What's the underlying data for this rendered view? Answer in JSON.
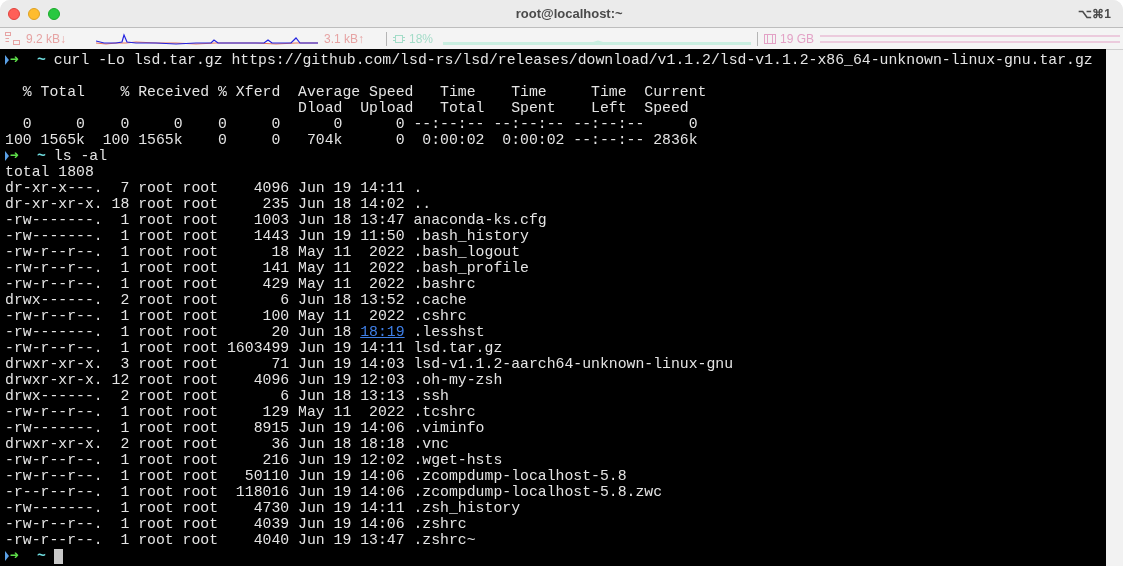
{
  "window": {
    "title": "root@localhost:~",
    "shortcut": "⌥⌘1"
  },
  "status_bar": {
    "network_down": "9.2 kB↓",
    "network_up": "3.1 kB↑",
    "cpu": "18%",
    "memory": "19 GB"
  },
  "terminal": {
    "lines": [
      {
        "kind": "prompt",
        "arrow": "➜",
        "cwd": "~",
        "command": "curl -Lo lsd.tar.gz https://github.com/lsd-rs/lsd/releases/download/v1.1.2/lsd-v1.1.2-x86_64-unknown-linux-gnu.tar.gz",
        "cursor": false
      },
      {
        "kind": "blank"
      },
      {
        "kind": "output",
        "text": "  % Total    % Received % Xferd  Average Speed   Time    Time     Time  Current"
      },
      {
        "kind": "output",
        "text": "                                 Dload  Upload   Total   Spent    Left  Speed"
      },
      {
        "kind": "output",
        "text": "  0     0    0     0    0     0      0      0 --:--:-- --:--:-- --:--:--     0"
      },
      {
        "kind": "output",
        "text": "100 1565k  100 1565k    0     0   704k      0  0:00:02  0:00:02 --:--:-- 2836k"
      },
      {
        "kind": "prompt",
        "arrow": "➜",
        "cwd": "~",
        "command": "ls -al",
        "cursor": false
      },
      {
        "kind": "output",
        "text": "total 1808"
      },
      {
        "kind": "output",
        "text": "dr-xr-x---.  7 root root    4096 Jun 19 14:11 ."
      },
      {
        "kind": "output",
        "text": "dr-xr-xr-x. 18 root root     235 Jun 18 14:02 .."
      },
      {
        "kind": "output",
        "text": "-rw-------.  1 root root    1003 Jun 18 13:47 anaconda-ks.cfg"
      },
      {
        "kind": "output",
        "text": "-rw-------.  1 root root    1443 Jun 19 11:50 .bash_history"
      },
      {
        "kind": "output",
        "text": "-rw-r--r--.  1 root root      18 May 11  2022 .bash_logout"
      },
      {
        "kind": "output",
        "text": "-rw-r--r--.  1 root root     141 May 11  2022 .bash_profile"
      },
      {
        "kind": "output",
        "text": "-rw-r--r--.  1 root root     429 May 11  2022 .bashrc"
      },
      {
        "kind": "output",
        "text": "drwx------.  2 root root       6 Jun 18 13:52 .cache"
      },
      {
        "kind": "output",
        "text": "-rw-r--r--.  1 root root     100 May 11  2022 .cshrc"
      },
      {
        "kind": "segmented",
        "segments": [
          {
            "text": "-rw-------.  1 root root      20 Jun 18 ",
            "link": false
          },
          {
            "text": "18:19",
            "link": true
          },
          {
            "text": " .lesshst",
            "link": false
          }
        ]
      },
      {
        "kind": "output",
        "text": "-rw-r--r--.  1 root root 1603499 Jun 19 14:11 lsd.tar.gz"
      },
      {
        "kind": "output",
        "text": "drwxr-xr-x.  3 root root      71 Jun 19 14:03 lsd-v1.1.2-aarch64-unknown-linux-gnu"
      },
      {
        "kind": "output",
        "text": "drwxr-xr-x. 12 root root    4096 Jun 19 12:03 .oh-my-zsh"
      },
      {
        "kind": "output",
        "text": "drwx------.  2 root root       6 Jun 18 13:13 .ssh"
      },
      {
        "kind": "output",
        "text": "-rw-r--r--.  1 root root     129 May 11  2022 .tcshrc"
      },
      {
        "kind": "output",
        "text": "-rw-------.  1 root root    8915 Jun 19 14:06 .viminfo"
      },
      {
        "kind": "output",
        "text": "drwxr-xr-x.  2 root root      36 Jun 18 18:18 .vnc"
      },
      {
        "kind": "output",
        "text": "-rw-r--r--.  1 root root     216 Jun 19 12:02 .wget-hsts"
      },
      {
        "kind": "output",
        "text": "-rw-r--r--.  1 root root   50110 Jun 19 14:06 .zcompdump-localhost-5.8"
      },
      {
        "kind": "output",
        "text": "-r--r--r--.  1 root root  118016 Jun 19 14:06 .zcompdump-localhost-5.8.zwc"
      },
      {
        "kind": "output",
        "text": "-rw-------.  1 root root    4730 Jun 19 14:11 .zsh_history"
      },
      {
        "kind": "output",
        "text": "-rw-r--r--.  1 root root    4039 Jun 19 14:06 .zshrc"
      },
      {
        "kind": "output",
        "text": "-rw-r--r--.  1 root root    4040 Jun 19 13:47 .zshrc~"
      },
      {
        "kind": "prompt",
        "arrow": "➜",
        "cwd": "~",
        "cursor": true
      }
    ]
  }
}
